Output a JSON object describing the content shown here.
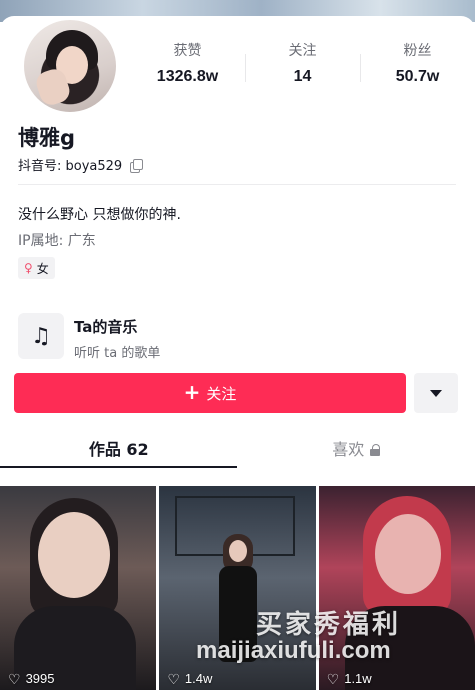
{
  "profile": {
    "name": "博雅g",
    "uid_label": "抖音号: boya529",
    "bio": "没什么野心 只想做你的神.",
    "ip_location": "IP属地:  广东",
    "gender": "女"
  },
  "stats": [
    {
      "label": "获赞",
      "value": "1326.8w"
    },
    {
      "label": "关注",
      "value": "14"
    },
    {
      "label": "粉丝",
      "value": "50.7w"
    }
  ],
  "music": {
    "title": "Ta的音乐",
    "subtitle": "听听 ta 的歌单",
    "icon": "music-note-icon"
  },
  "actions": {
    "follow_label": "关注",
    "follow_plus": "+",
    "more_icon": "caret-down-icon"
  },
  "tabs": [
    {
      "label": "作品 62",
      "active": true
    },
    {
      "label": "喜欢",
      "active": false,
      "locked": true
    }
  ],
  "videos": [
    {
      "likes": "3995"
    },
    {
      "likes": "1.4w"
    },
    {
      "likes": "1.1w"
    }
  ],
  "watermark": {
    "cn": "买家秀福利",
    "en": "maijiaxiufuli.com"
  },
  "colors": {
    "accent": "#fe2c55",
    "text_primary": "#161823",
    "text_secondary": "#6b6d75",
    "female": "#f0506e"
  }
}
